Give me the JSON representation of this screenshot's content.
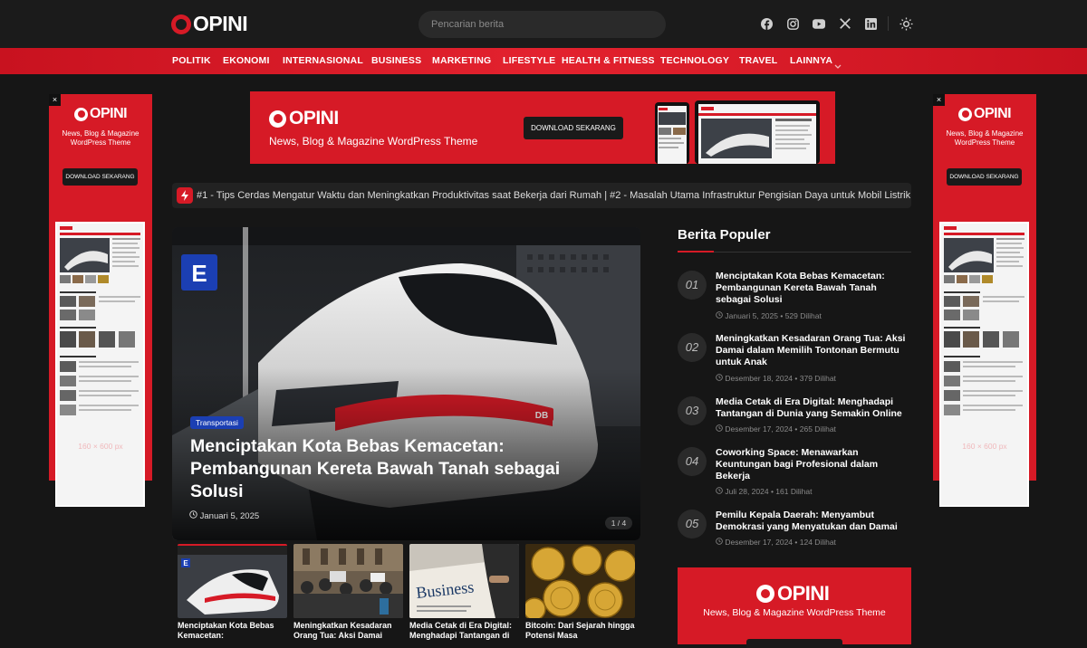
{
  "header": {
    "logo_text": "OPINI",
    "search_placeholder": "Pencarian berita",
    "social_icons": [
      "facebook-icon",
      "instagram-icon",
      "youtube-icon",
      "x-icon",
      "linkedin-icon"
    ],
    "theme_icon": "sun-icon"
  },
  "nav": {
    "items": [
      "POLITIK",
      "EKONOMI",
      "INTERNASIONAL",
      "BUSINESS",
      "MARKETING",
      "LIFESTYLE",
      "HEALTH & FITNESS",
      "TECHNOLOGY",
      "TRAVEL",
      "LAINNYA"
    ]
  },
  "side_ads": {
    "logo_text": "OPINI",
    "tagline_1": "News, Blog & Magazine",
    "tagline_2": "WordPress Theme",
    "button": "DOWNLOAD SEKARANG",
    "size": "160 × 600 px",
    "close": "×"
  },
  "banner": {
    "logo_text": "OPINI",
    "tagline": "News, Blog & Magazine WordPress Theme",
    "button": "DOWNLOAD SEKARANG"
  },
  "ticker": {
    "text": "#1 - Tips Cerdas Mengatur Waktu dan Meningkatkan Produktivitas saat Bekerja dari Rumah   |   #2 - Masalah Utama Infrastruktur Pengisian Daya untuk Mobil Listrik yang"
  },
  "hero": {
    "category": "Transportasi",
    "title": "Menciptakan Kota Bebas Kemacetan: Pembangunan Kereta Bawah Tanah sebagai Solusi",
    "date": "Januari 5, 2025",
    "counter": "1 / 4",
    "sign_letter": "E",
    "train_logo": "DB"
  },
  "thumbs": [
    {
      "title": "Menciptakan Kota Bebas Kemacetan:"
    },
    {
      "title": "Meningkatkan Kesadaran Orang Tua: Aksi Damai"
    },
    {
      "title": "Media Cetak di Era Digital: Menghadapi Tantangan di"
    },
    {
      "title": "Bitcoin: Dari Sejarah hingga Potensi Masa"
    }
  ],
  "thumb_newspaper_word": "Business",
  "popular": {
    "heading": "Berita Populer",
    "items": [
      {
        "num": "01",
        "title": "Menciptakan Kota Bebas Kemacetan: Pembangunan Kereta Bawah Tanah sebagai Solusi",
        "date": "Januari 5, 2025",
        "views": "529 Dilihat"
      },
      {
        "num": "02",
        "title": "Meningkatkan Kesadaran Orang Tua: Aksi Damai dalam Memilih Tontonan Bermutu untuk Anak",
        "date": "Desember 18, 2024",
        "views": "379 Dilihat"
      },
      {
        "num": "03",
        "title": "Media Cetak di Era Digital: Menghadapi Tantangan di Dunia yang Semakin Online",
        "date": "Desember 17, 2024",
        "views": "265 Dilihat"
      },
      {
        "num": "04",
        "title": "Coworking Space: Menawarkan Keuntungan bagi Profesional dalam Bekerja",
        "date": "Juli 28, 2024",
        "views": "161 Dilihat"
      },
      {
        "num": "05",
        "title": "Pemilu Kepala Daerah: Menyambut Demokrasi yang Menyatukan dan Damai",
        "date": "Desember 17, 2024",
        "views": "124 Dilihat"
      }
    ]
  },
  "bottom_ad": {
    "logo_text": "OPINI",
    "tagline": "News, Blog & Magazine WordPress Theme"
  },
  "colors": {
    "accent": "#d61a26",
    "background": "#161616",
    "badge": "#1b3fb3"
  }
}
